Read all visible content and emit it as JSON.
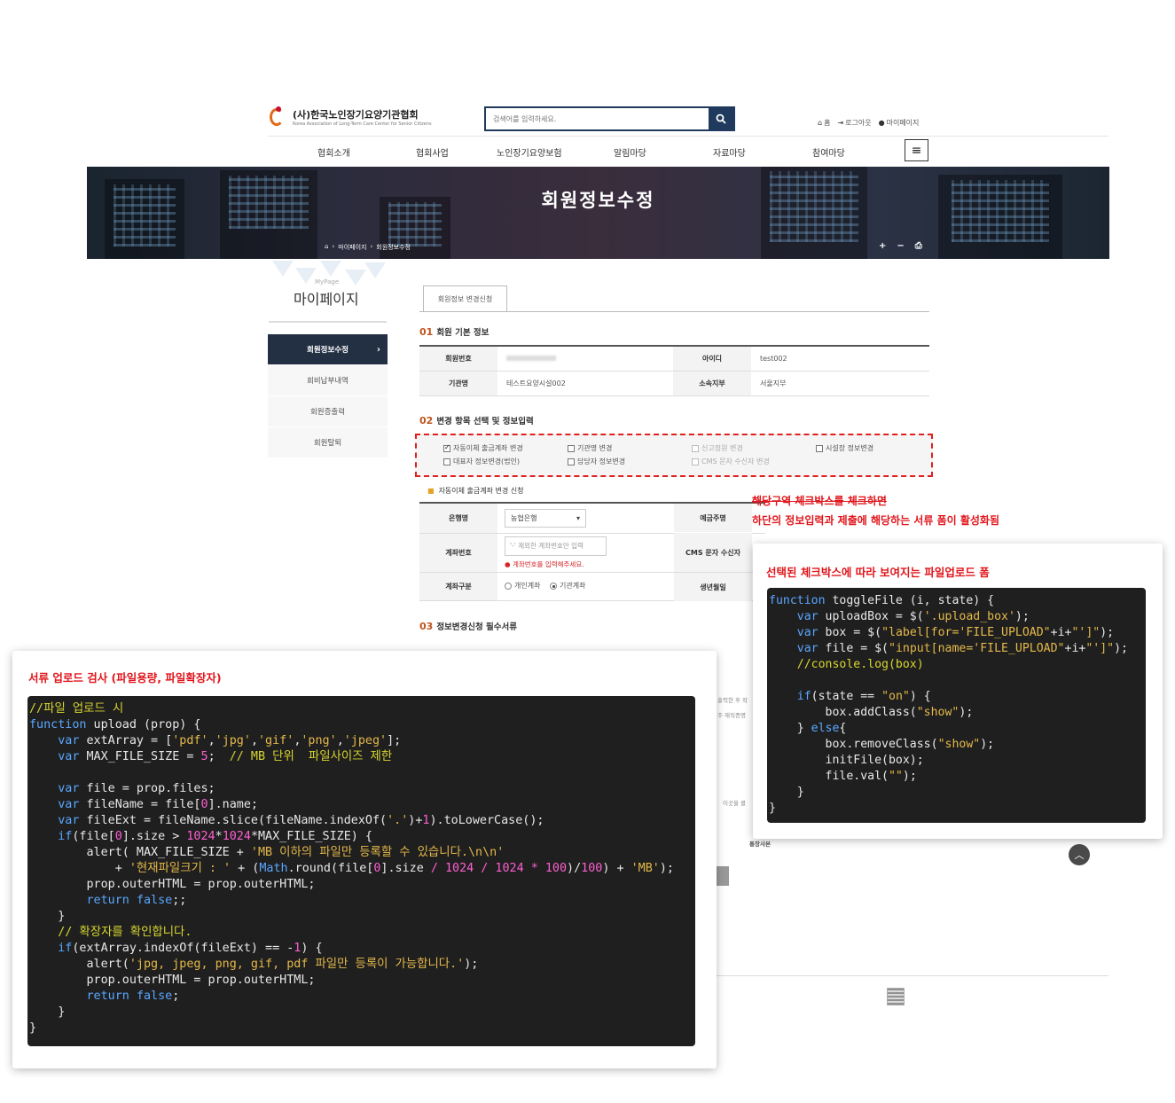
{
  "header": {
    "logo_title": "(사)한국노인장기요양기관협회",
    "logo_subtitle": "Korea Association of Long-Term Care Center for Senior Citizens",
    "search_placeholder": "검색어를 입력하세요.",
    "util": {
      "home": "홈",
      "logout": "로그아웃",
      "mypage": "마이페이지"
    },
    "nav": [
      "협회소개",
      "협회사업",
      "노인장기요양보험",
      "알림마당",
      "자료마당",
      "참여마당"
    ]
  },
  "hero": {
    "title": "회원정보수정",
    "breadcrumb": [
      "마이페이지",
      "회원정보수정"
    ],
    "tools": [
      "+",
      "−",
      "⎙"
    ]
  },
  "side": {
    "sub": "MyPage",
    "title": "마이페이지",
    "menu": [
      "회원정보수정",
      "회비납부내역",
      "회원증출력",
      "회원탈퇴"
    ]
  },
  "content": {
    "tab": "회원정보 변경신청",
    "sec1": {
      "num": "01",
      "title": "회원 기본 정보"
    },
    "info": {
      "member_no_label": "회원번호",
      "member_no_value": "",
      "id_label": "아이디",
      "id_value": "test002",
      "org_label": "기관명",
      "org_value": "테스트요양시설002",
      "branch_label": "소속지부",
      "branch_value": "서울지부"
    },
    "sec2": {
      "num": "02",
      "title": "변경 항목 선택 및 정보입력"
    },
    "checkboxes": [
      {
        "label": "자동이체 출금계좌 변경",
        "checked": true,
        "disabled": false
      },
      {
        "label": "기관명 변경",
        "checked": false,
        "disabled": false
      },
      {
        "label": "신고정원 변경",
        "checked": false,
        "disabled": true
      },
      {
        "label": "시설장 정보변경",
        "checked": false,
        "disabled": false
      },
      {
        "label": "대표자 정보변경(법인)",
        "checked": false,
        "disabled": false
      },
      {
        "label": "담당자 정보변경",
        "checked": false,
        "disabled": false
      },
      {
        "label": "CMS 문자 수신자 변경",
        "checked": false,
        "disabled": true
      }
    ],
    "subsection": "자동이체 출금계좌 변경 신청",
    "account": {
      "bank_label": "은행명",
      "bank_value": "농협은행",
      "depositor_label": "예금주명",
      "acct_label": "계좌번호",
      "acct_placeholder": "'-' 제외한 계좌번호만 입력",
      "acct_warn": "계좌번호를 입력해주세요.",
      "cms_label": "CMS 문자 수신자",
      "type_label": "계좌구분",
      "type_personal": "개인계좌",
      "type_org": "기관계좌",
      "birth_label": "생년월일"
    },
    "sec3": {
      "num": "03",
      "title": "정보변경신청 필수서류"
    },
    "peek": [
      "출력한 후 작",
      "주 재직증명",
      "이곳을 클",
      "통장사본"
    ]
  },
  "notes": {
    "line1": "해당구역 체크박스를 체크하면",
    "line2": "하단의 정보입력과 제출에 해당하는 서류 폼이 활성화됨"
  },
  "panel_right": {
    "title": "선택된 체크박스에 따라 보여지는 파일업로드 폼",
    "code": [
      "function toggleFile (i, state) {",
      "    var uploadBox = $('.upload_box');",
      "    var box = $(\"label[for='FILE_UPLOAD\"+i+\"']\");",
      "    var file = $(\"input[name='FILE_UPLOAD\"+i+\"']\");",
      "    //console.log(box)",
      "",
      "    if(state == \"on\") {",
      "        box.addClass(\"show\");",
      "    } else{",
      "        box.removeClass(\"show\");",
      "        initFile(box);",
      "        file.val(\"\");",
      "    }",
      "}"
    ]
  },
  "panel_left": {
    "title": "서류 업로드 검사 (파일용량, 파일확장자)",
    "code": [
      "//파일 업로드 시",
      "function upload (prop) {",
      "    var extArray = ['pdf','jpg','gif','png','jpeg'];",
      "    var MAX_FILE_SIZE = 5;  // MB 단위  파일사이즈 제한",
      "",
      "    var file = prop.files;",
      "    var fileName = file[0].name;",
      "    var fileExt = fileName.slice(fileName.indexOf('.')+1).toLowerCase();",
      "    if(file[0].size > 1024*1024*MAX_FILE_SIZE) {",
      "        alert( MAX_FILE_SIZE + 'MB 이하의 파일만 등록할 수 있습니다.\\n\\n'",
      "            + '현재파일크기 : ' + (Math.round(file[0].size / 1024 / 1024 * 100)/100) + 'MB');",
      "        prop.outerHTML = prop.outerHTML;",
      "        return false;;",
      "    }",
      "    // 확장자를 확인합니다.",
      "    if(extArray.indexOf(fileExt) == -1) {",
      "        alert('jpg, jpeg, png, gif, pdf 파일만 등록이 가능합니다.');",
      "        prop.outerHTML = prop.outerHTML;",
      "        return false;",
      "    }",
      "}"
    ]
  },
  "colors": {
    "accent_red": "#e0161c",
    "nav_dark": "#233044",
    "code_bg": "#1f1f1f",
    "keyword": "#5aa7ff",
    "string": "#e5b94a",
    "comment": "#d9d630",
    "number": "#ff5fd1"
  }
}
